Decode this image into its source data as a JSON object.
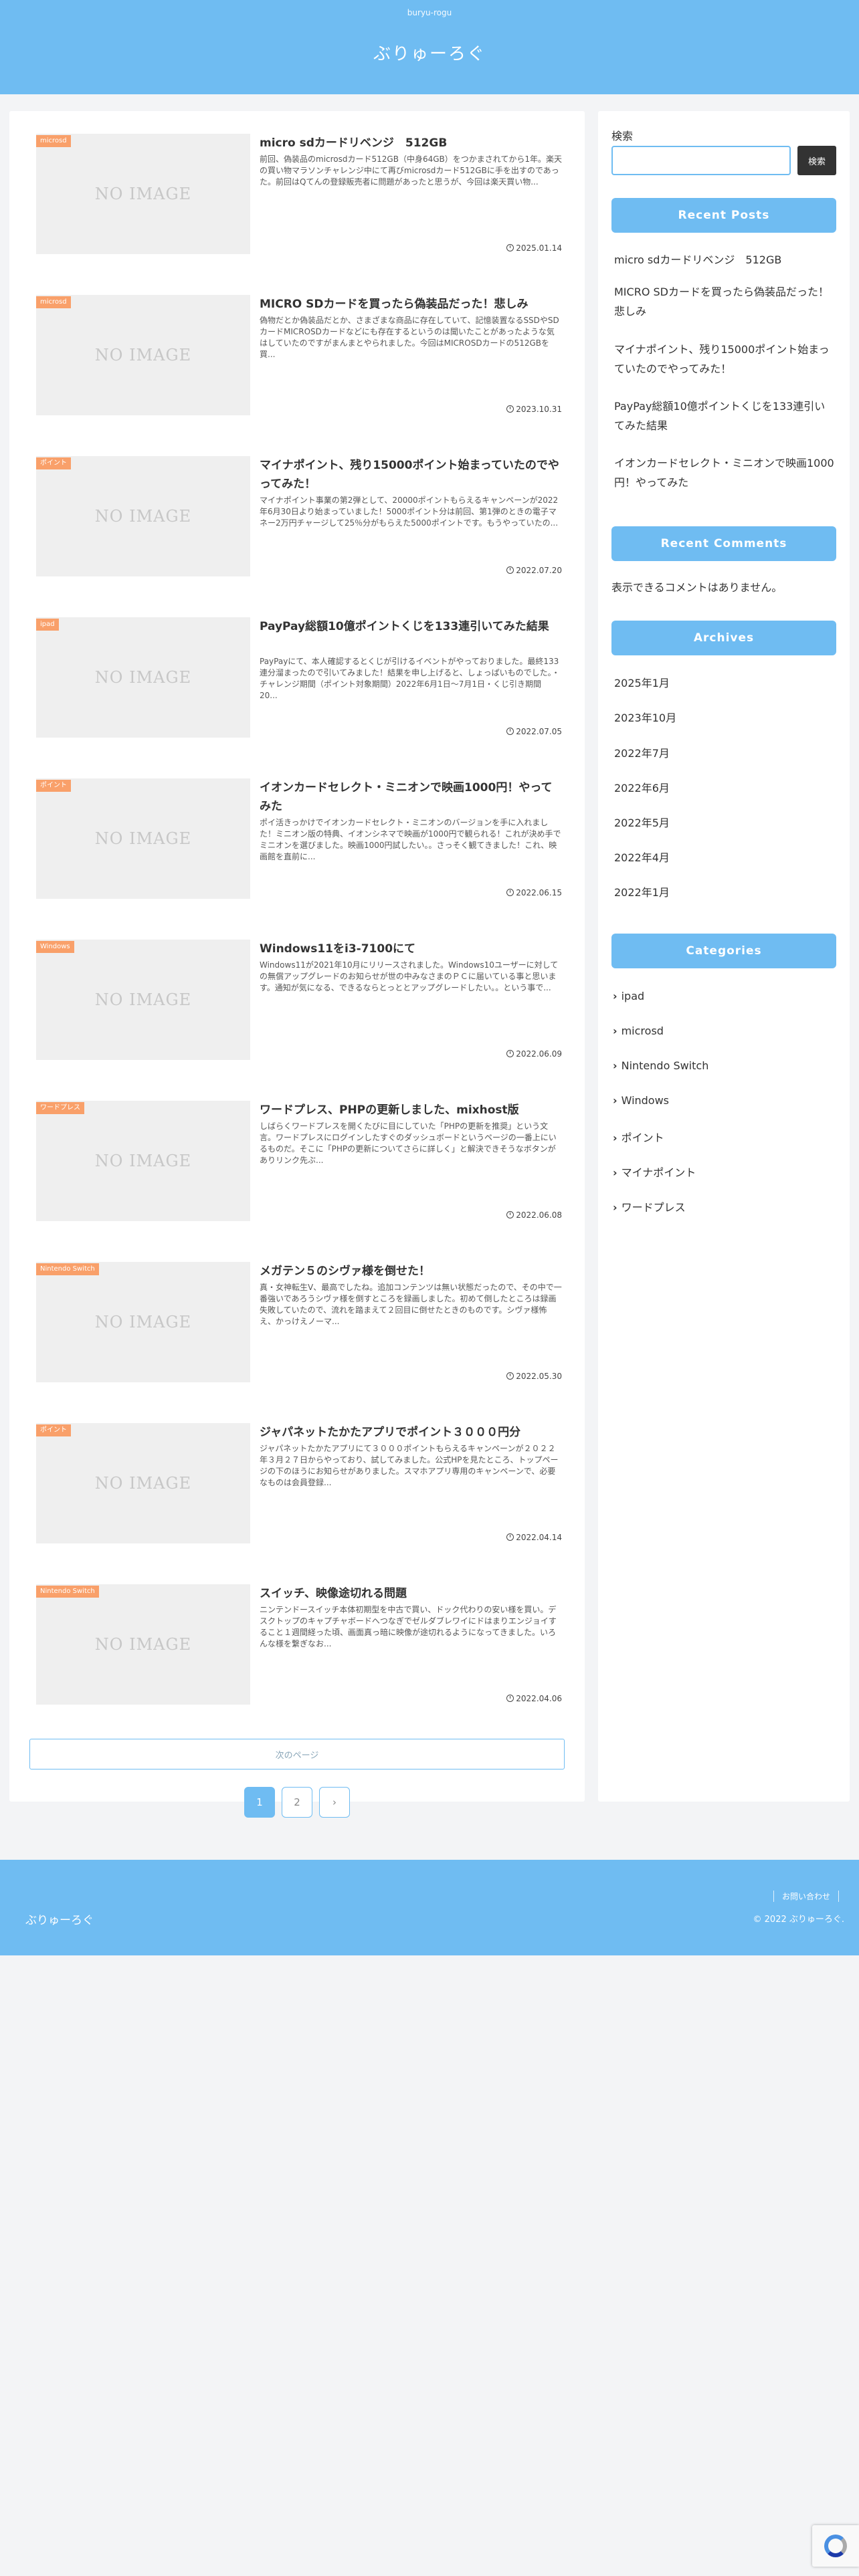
{
  "header": {
    "tagline": "buryu-rogu",
    "site_title": "ぶりゅーろぐ"
  },
  "posts": [
    {
      "category": "microsd",
      "title": "micro sdカードリベンジ　512GB",
      "snippet": "前回、偽装品のmicrosdカード512GB（中身64GB）をつかまされてから1年。楽天の買い物マラソンチャレンジ中にて再びmicrosdカード512GBに手を出すのであった。前回はQてんの登録販売者に問題があったと思うが、今回は楽天買い物...",
      "thumb_text": "NO IMAGE",
      "date": "2025.01.14"
    },
    {
      "category": "microsd",
      "title": "MICRO SDカードを買ったら偽装品だった！悲しみ",
      "snippet": "偽物だとか偽装品だとか、さまざまな商品に存在していて、記憶装置なるSSDやSDカードMICROSDカードなどにも存在するというのは聞いたことがあったような気はしていたのですがまんまとやられました。今回はMICROSDカードの512GBを買...",
      "thumb_text": "NO IMAGE",
      "date": "2023.10.31"
    },
    {
      "category": "ポイント",
      "title": "マイナポイント、残り15000ポイント始まっていたのでやってみた！",
      "snippet": "マイナポイント事業の第2弾として、20000ポイントもらえるキャンペーンが2022年6月30日より始まっていました！5000ポイント分は前回、第1弾のときの電子マネー2万円チャージして25％分がもらえた5000ポイントです。もうやっていたの...",
      "thumb_text": "NO IMAGE",
      "date": "2022.07.20"
    },
    {
      "category": "ipad",
      "title": "PayPay総額10億ポイントくじを133連引いてみた結果",
      "snippet": "PayPayにて、本人確認するとくじが引けるイベントがやっておりました。最終133連分溜まったので引いてみました！結果を申し上げると、しょっぱいものでした。・チャレンジ期間（ポイント対象期間）2022年6月1日〜7月1日・くじ引き期間　20...",
      "thumb_text": "NO IMAGE",
      "date": "2022.07.05"
    },
    {
      "category": "ポイント",
      "title": "イオンカードセレクト・ミニオンで映画1000円！やってみた",
      "snippet": "ポイ活きっかけでイオンカードセレクト・ミニオンのバージョンを手に入れました！ミニオン版の特典、イオンシネマで映画が1000円で観られる！これが決め手でミニオンを選びました。映画1000円試したい。。さっそく観てきました！これ、映画館を直前に...",
      "thumb_text": "NO IMAGE",
      "date": "2022.06.15"
    },
    {
      "category": "Windows",
      "title": "Windows11をi3-7100にて",
      "snippet": "Windows11が2021年10月にリリースされました。Windows10ユーザーに対しての無償アップグレードのお知らせが世の中みなさまのＰＣに届いている事と思います。通知が気になる、できるならとっととアップグレードしたい。。という事で...",
      "thumb_text": "NO IMAGE",
      "date": "2022.06.09"
    },
    {
      "category": "ワードプレス",
      "title": "ワードプレス、PHPの更新しました、mixhost版",
      "snippet": "しばらくワードプレスを開くたびに目にしていた「PHPの更新を推奨」という文言。ワードプレスにログインしたすぐのダッシュボードというページの一番上にいるものだ。そこに「PHPの更新についてさらに詳しく」と解決できそうなボタンがありリンク先ぶ...",
      "thumb_text": "NO IMAGE",
      "date": "2022.06.08"
    },
    {
      "category": "Nintendo Switch",
      "title": "メガテン５のシヴァ様を倒せた！",
      "snippet": "真・女神転生V、最高でしたね。追加コンテンツは無い状態だったので、その中で一番強いであろうシヴァ様を倒すところを録画しました。初めて倒したところは録画失敗していたので、流れを踏まえて２回目に倒せたときのものです。シヴァ様怖え、かっけえノーマ...",
      "thumb_text": "NO IMAGE",
      "date": "2022.05.30"
    },
    {
      "category": "ポイント",
      "title": "ジャパネットたかたアプリでポイント３０００円分",
      "snippet": "ジャパネットたかたアプリにて３０００ポイントもらえるキャンペーンが２０２２年３月２７日からやっており、試してみました。公式HPを見たところ、トップページの下のほうにお知らせがありました。スマホアプリ専用のキャンペーンで、必要なものは会員登録...",
      "thumb_text": "NO IMAGE",
      "date": "2022.04.14"
    },
    {
      "category": "Nintendo Switch",
      "title": "スイッチ、映像途切れる問題",
      "snippet": "ニンテンドースイッチ本体初期型を中古で買い、ドック代わりの安い様を買い。デスクトップのキャプチャボードへつなぎでゼルダブレワイにドはまりエンジョイすること１週間経った頃、画面真っ暗に映像が途切れるようになってきました。いろんな様を繋ぎなお...",
      "thumb_text": "NO IMAGE",
      "date": "2022.04.06"
    }
  ],
  "pagination": {
    "next_label": "次のページ",
    "pages": [
      "1",
      "2"
    ],
    "next_arrow": "›"
  },
  "sidebar": {
    "search_label": "検索",
    "search_button": "検索",
    "recent_posts_title": "Recent Posts",
    "recent_posts": [
      "micro sdカードリベンジ　512GB",
      "MICRO SDカードを買ったら偽装品だった！悲しみ",
      "マイナポイント、残り15000ポイント始まっていたのでやってみた！",
      "PayPay総額10億ポイントくじを133連引いてみた結果",
      "イオンカードセレクト・ミニオンで映画1000円！やってみた"
    ],
    "recent_comments_title": "Recent Comments",
    "no_comments": "表示できるコメントはありません。",
    "archives_title": "Archives",
    "archives": [
      "2025年1月",
      "2023年10月",
      "2022年7月",
      "2022年6月",
      "2022年5月",
      "2022年4月",
      "2022年1月"
    ],
    "categories_title": "Categories",
    "categories": [
      "ipad",
      "microsd",
      "Nintendo Switch",
      "Windows",
      "ポイント",
      "マイナポイント",
      "ワードプレス"
    ]
  },
  "footer": {
    "site_title": "ぶりゅーろぐ",
    "contact": "お問い合わせ",
    "copyright": "© 2022 ぶりゅーろぐ."
  },
  "icons": {
    "date": "clock-icon",
    "category_bullet": "chevron-right-icon",
    "recaptcha": "recaptcha-icon"
  },
  "colors": {
    "accent": "#6fbcf2",
    "category_badge": "#f9a06a",
    "search_button": "#333333"
  }
}
